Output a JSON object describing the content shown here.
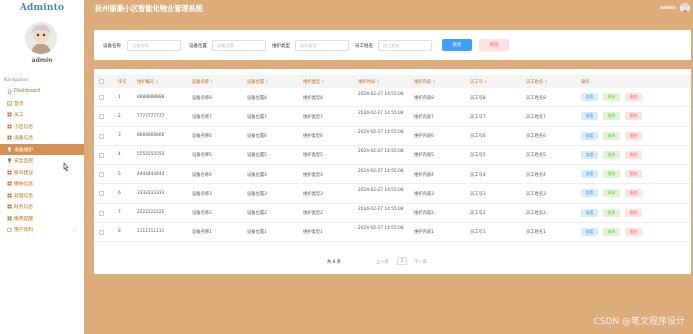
{
  "brand": "Adminto",
  "sidebar": {
    "username": "admin",
    "nav_caption": "Navigation",
    "items": [
      {
        "label": "Dashboard",
        "icon": "home-icon"
      },
      {
        "label": "首页",
        "icon": "list-icon"
      },
      {
        "label": "员工",
        "icon": "grid-icon"
      },
      {
        "label": "小区信息",
        "icon": "grid-icon"
      },
      {
        "label": "设备信息",
        "icon": "grid-icon"
      },
      {
        "label": "设备维护",
        "icon": "trophy-icon"
      },
      {
        "label": "安全监控",
        "icon": "trophy-icon"
      },
      {
        "label": "投诉建议",
        "icon": "grid-icon"
      },
      {
        "label": "缴纳信息",
        "icon": "grid-icon"
      },
      {
        "label": "处理信息",
        "icon": "grid-icon"
      },
      {
        "label": "财务信息",
        "icon": "grid-icon"
      },
      {
        "label": "缴费提醒",
        "icon": "grid-icon"
      },
      {
        "label": "用户资料",
        "icon": "folder-icon"
      }
    ],
    "active_index": 5
  },
  "header": {
    "title": "抚州丽豪小区智能化物业管理系统",
    "user": "admin"
  },
  "search": {
    "fields": [
      {
        "label": "设备名称",
        "placeholder": "设备名称"
      },
      {
        "label": "设备位置",
        "placeholder": "设备位置"
      },
      {
        "label": "维护类型",
        "placeholder": "维护类型"
      },
      {
        "label": "员工姓名",
        "placeholder": "员工姓名"
      }
    ],
    "search_label": "搜索",
    "delete_label": "删除"
  },
  "table": {
    "columns": [
      "序号",
      "维护编号",
      "设备名称",
      "设备位置",
      "维护类型",
      "维护时间",
      "维护内容",
      "员工号",
      "员工姓名",
      "操作"
    ],
    "sortable": [
      false,
      true,
      true,
      true,
      true,
      true,
      true,
      true,
      true,
      false
    ],
    "sort_glyph": "⇕",
    "rows": [
      {
        "no": "1",
        "code": "8888888888",
        "name": "设备名称8",
        "loc": "设备位置8",
        "type": "维护类型8",
        "time": "2024-02-27 14:55:08",
        "content": "维护内容8",
        "emp_no": "员工号8",
        "emp_name": "员工姓名8"
      },
      {
        "no": "2",
        "code": "7777777777",
        "name": "设备名称7",
        "loc": "设备位置7",
        "type": "维护类型7",
        "time": "2024-02-27 14:55:08",
        "content": "维护内容7",
        "emp_no": "员工号7",
        "emp_name": "员工姓名7"
      },
      {
        "no": "3",
        "code": "6666666666",
        "name": "设备名称6",
        "loc": "设备位置6",
        "type": "维护类型6",
        "time": "2024-02-27 14:55:08",
        "content": "维护内容6",
        "emp_no": "员工号6",
        "emp_name": "员工姓名6"
      },
      {
        "no": "4",
        "code": "5555555555",
        "name": "设备名称5",
        "loc": "设备位置5",
        "type": "维护类型5",
        "time": "2024-02-27 14:55:08",
        "content": "维护内容5",
        "emp_no": "员工号5",
        "emp_name": "员工姓名5"
      },
      {
        "no": "5",
        "code": "4444444444",
        "name": "设备名称4",
        "loc": "设备位置4",
        "type": "维护类型4",
        "time": "2024-02-27 14:55:08",
        "content": "维护内容4",
        "emp_no": "员工号4",
        "emp_name": "员工姓名4"
      },
      {
        "no": "6",
        "code": "3333333333",
        "name": "设备名称3",
        "loc": "设备位置3",
        "type": "维护类型3",
        "time": "2024-02-27 14:55:08",
        "content": "维护内容3",
        "emp_no": "员工号3",
        "emp_name": "员工姓名3"
      },
      {
        "no": "7",
        "code": "2222222222",
        "name": "设备名称2",
        "loc": "设备位置2",
        "type": "维护类型2",
        "time": "2024-02-27 14:55:08",
        "content": "维护内容2",
        "emp_no": "员工号2",
        "emp_name": "员工姓名2"
      },
      {
        "no": "8",
        "code": "1111111111",
        "name": "设备名称1",
        "loc": "设备位置1",
        "type": "维护类型1",
        "time": "2024-02-27 14:55:08",
        "content": "维护内容1",
        "emp_no": "员工号1",
        "emp_name": "员工姓名1"
      }
    ],
    "actions": {
      "view": "查看",
      "edit": "修改",
      "delete": "删除"
    }
  },
  "pagination": {
    "total": "共 8 条",
    "prev": "上一页",
    "current": "1",
    "next": "下一页"
  },
  "watermark": "CSDN @笔文程序设计",
  "colors": {
    "background": "#dcac7a",
    "accent": "#c16d1f",
    "active_nav": "#d59053",
    "primary": "#409eff",
    "danger": "#f56c6c"
  }
}
